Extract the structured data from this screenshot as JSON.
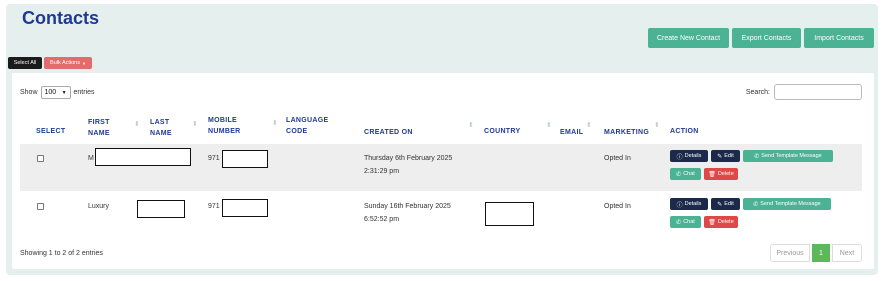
{
  "page": {
    "title": "Contacts"
  },
  "top_actions": {
    "create": "Create New Contact",
    "export": "Export Contacts",
    "import": "Import Contacts"
  },
  "bulk": {
    "select_all": "Select All",
    "bulk_actions": "Bulk Actions"
  },
  "table_controls": {
    "show_label": "Show",
    "page_length": "100",
    "entries_label": "entries",
    "search_label": "Search:"
  },
  "columns": {
    "select": "SELECT",
    "first_name_1": "FIRST",
    "first_name_2": "NAME",
    "last_name_1": "LAST",
    "last_name_2": "NAME",
    "mobile_1": "MOBILE",
    "mobile_2": "NUMBER",
    "language_1": "LANGUAGE",
    "language_2": "CODE",
    "created_on": "CREATED ON",
    "country": "COUNTRY",
    "email": "EMAIL",
    "marketing": "MARKETING",
    "action": "ACTION"
  },
  "rows": [
    {
      "first_name": "M",
      "mobile": "971",
      "created_date": "Thursday 6th February 2025",
      "created_time": "2:31:29 pm",
      "marketing": "Opted In"
    },
    {
      "first_name": "Luxury",
      "mobile": "971",
      "created_date": "Sunday 16th February 2025",
      "created_time": "6:52:52 pm",
      "marketing": "Opted In"
    }
  ],
  "row_actions": {
    "details": "Details",
    "edit": "Edit",
    "send_template": "Send Template Message",
    "chat": "Chat",
    "delete": "Delete"
  },
  "footer": {
    "info": "Showing 1 to 2 of 2 entries",
    "previous": "Previous",
    "current_page": "1",
    "next": "Next"
  },
  "colors": {
    "accent_green": "#4bb393",
    "title_blue": "#1f3a93",
    "danger_red": "#e04848",
    "dark_navy": "#1b2a4a"
  }
}
